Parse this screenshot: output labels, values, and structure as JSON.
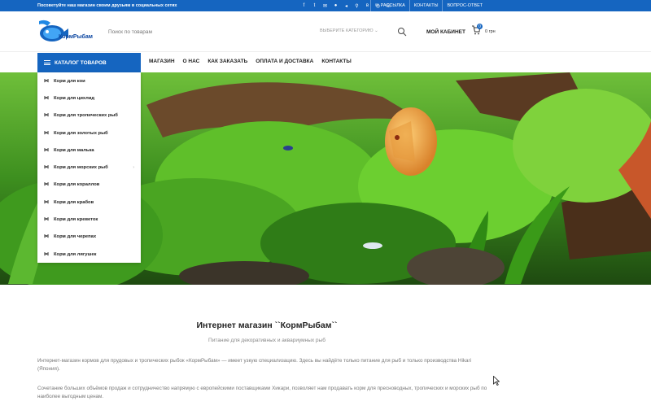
{
  "topbar": {
    "promo": "Посоветуйте наш магазин своим друзьям в социальных сетях",
    "socials": [
      "facebook-icon",
      "twitter-icon",
      "email-icon",
      "pinterest-icon",
      "telegram-icon",
      "odnoklassniki-icon",
      "vk-icon",
      "whatsapp-icon",
      "viber-icon"
    ],
    "links": [
      {
        "label": "РАССЫЛКА",
        "icon": "envelope-icon"
      },
      {
        "label": "КОНТАКТЫ"
      },
      {
        "label": "ВОПРОС-ОТВЕТ"
      }
    ]
  },
  "header": {
    "logo_text": "КормРыбам",
    "search_placeholder": "Поиск по товарам",
    "category_select": "ВЫБЕРИТЕ КАТЕГОРИЮ",
    "account": "МОЙ КАБИНЕТ",
    "cart_count": "0",
    "cart_total": "0 грн"
  },
  "nav": {
    "catalog": "КАТАЛОГ ТОВАРОВ",
    "items": [
      "МАГАЗИН",
      "О НАС",
      "КАК ЗАКАЗАТЬ",
      "ОПЛАТА И ДОСТАВКА",
      "КОНТАКТЫ"
    ]
  },
  "catalog_menu": [
    {
      "label": "Корм для кои",
      "arrow": false
    },
    {
      "label": "Корм для цихлид",
      "arrow": false
    },
    {
      "label": "Корм для тропических рыб",
      "arrow": false
    },
    {
      "label": "Корм для золотых рыб",
      "arrow": false
    },
    {
      "label": "Корм для малька",
      "arrow": false
    },
    {
      "label": "Корм для морских рыб",
      "arrow": true
    },
    {
      "label": "Корм для кораллов",
      "arrow": false
    },
    {
      "label": "Корм для крабов",
      "arrow": false
    },
    {
      "label": "Корм для креветок",
      "arrow": false
    },
    {
      "label": "Корм для черепах",
      "arrow": false
    },
    {
      "label": "Корм для лягушек",
      "arrow": false
    }
  ],
  "content": {
    "title": "Интернет магазин ``КормРыбам``",
    "subtitle": "Питание для декоративных и аквариумных рыб",
    "para1": "Интернет-магазин кормов для прудовых и тропических рыбок «КормРыбам» — имеет узкую специализацию.  Здесь вы найдёте только питание для рыб и только производства Hikari (Япония).",
    "para2": "Сочетание больших объёмов продаж и сотрудничество напрямую с европейскими поставщиками Хикари, позволяет нам продавать корм для пресноводных, тропических и морских рыб по наиболее выгодным ценам."
  },
  "colors": {
    "brand": "#1565c0"
  }
}
